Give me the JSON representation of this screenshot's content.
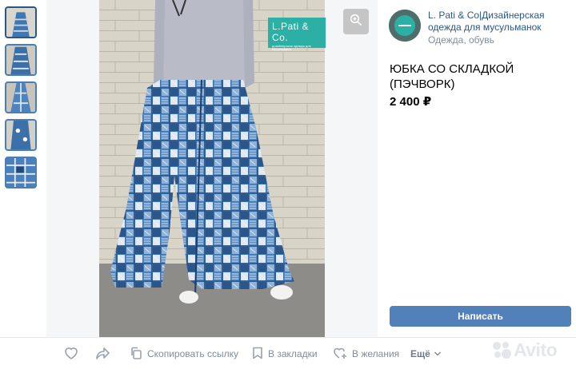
{
  "brand_logo": {
    "name": "L.Pati & Co.",
    "tagline": "дизайнерская одежда для мусульманок"
  },
  "seller": {
    "name": "L. Pati & Co|Дизайнерская одежда для мусульманок",
    "category": "Одежда, обувь"
  },
  "item": {
    "title": "ЮБКА СО СКЛАДКОЙ (ПЭЧВОРК)",
    "price": "2 400 ₽"
  },
  "actions": {
    "write_label": "Написать",
    "copy_link": "Скопировать ссылку",
    "bookmark": "В закладки",
    "wishlist": "В желания",
    "more": "Ещё"
  },
  "watermark": "Avito",
  "icons": [
    "like-icon",
    "share-icon",
    "copy-icon",
    "bookmark-icon",
    "wishlist-icon",
    "chevron-down-icon",
    "zoom-icon"
  ],
  "colors": {
    "link": "#2a5885",
    "button": "#5181b8",
    "muted": "#818c99",
    "logo_bg": "#2cb0a5"
  }
}
